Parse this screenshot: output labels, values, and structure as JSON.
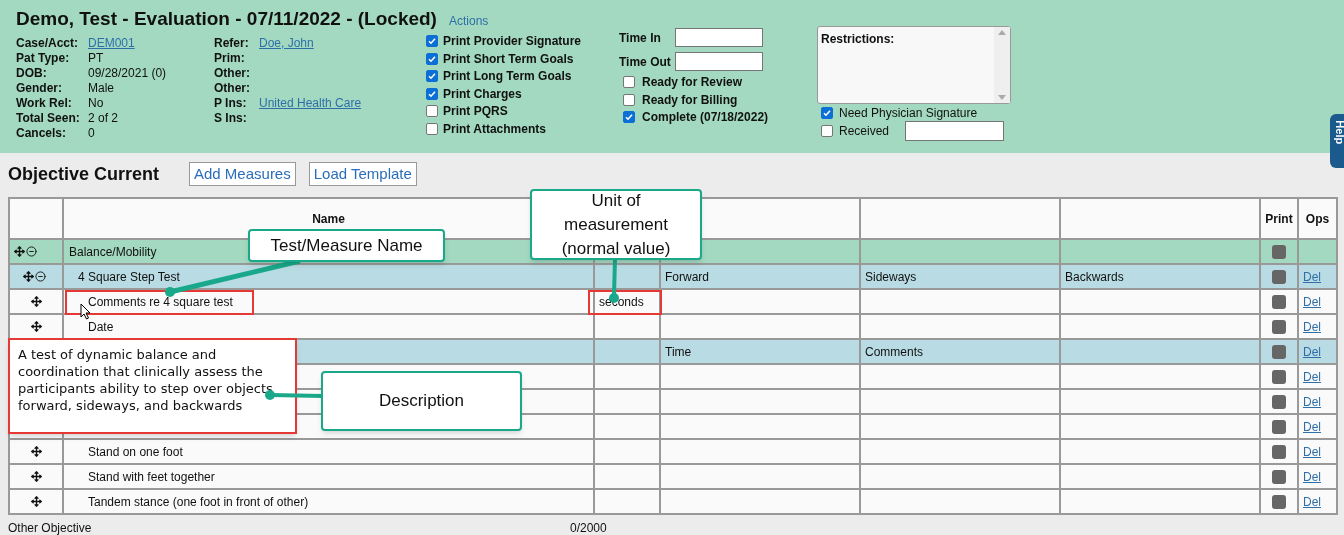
{
  "header": {
    "title": "Demo, Test - Evaluation - 07/11/2022 - (Locked)",
    "actions": "Actions",
    "patient_fields": [
      {
        "label": "Case/Acct:",
        "value": "DEM001",
        "link": true
      },
      {
        "label": "Pat Type:",
        "value": "PT",
        "link": false
      },
      {
        "label": "DOB:",
        "value": "09/28/2021 (0)",
        "link": false
      },
      {
        "label": "Gender:",
        "value": "Male",
        "link": false
      },
      {
        "label": "Work Rel:",
        "value": "No",
        "link": false
      },
      {
        "label": "Total Seen:",
        "value": "2 of 2",
        "link": false
      },
      {
        "label": "Cancels:",
        "value": "0",
        "link": false
      }
    ],
    "referral_fields": [
      {
        "label": "Refer:",
        "value": "Doe, John",
        "link": true
      },
      {
        "label": "Prim:"
      },
      {
        "label": "Other:"
      },
      {
        "label": "Other:"
      },
      {
        "label": "P Ins:",
        "value": "United Health Care",
        "link": true
      },
      {
        "label": "S Ins:"
      }
    ],
    "print_options": [
      {
        "label": "Print Provider Signature",
        "checked": true
      },
      {
        "label": "Print Short Term Goals",
        "checked": true
      },
      {
        "label": "Print Long Term Goals",
        "checked": true
      },
      {
        "label": "Print Charges",
        "checked": true
      },
      {
        "label": "Print PQRS",
        "checked": false
      },
      {
        "label": "Print Attachments",
        "checked": false
      }
    ],
    "time_fields": [
      {
        "label": "Time In"
      },
      {
        "label": "Time Out"
      }
    ],
    "status_options": [
      {
        "label": "Ready for Review",
        "checked": false
      },
      {
        "label": "Ready for Billing",
        "checked": false
      },
      {
        "label": "Complete (07/18/2022)",
        "checked": true
      }
    ],
    "restrictions": {
      "label": "Restrictions:"
    },
    "signature_options": [
      {
        "label": "Need Physician Signature",
        "checked": true,
        "field": false
      },
      {
        "label": "Received",
        "checked": false,
        "field": true
      }
    ],
    "help_tab": "Help"
  },
  "section": {
    "title": "Objective Current",
    "buttons": [
      "Add Measures",
      "Load Template"
    ]
  },
  "table": {
    "columns": [
      {
        "label": "Name"
      },
      {},
      {},
      {},
      {},
      {
        "label": "Print"
      },
      {
        "label": "Ops"
      }
    ],
    "rows": [
      {
        "name": "Balance/Mobility",
        "children": [
          {
            "name": "4 Square Step Test",
            "column_3": "Forward",
            "column_4": "Sideways",
            "column_5": "Backwards",
            "ops": "Del",
            "children": [
              {
                "name": "Comments re 4 square test",
                "unit": "seconds",
                "ops": "Del"
              },
              {
                "name": "Date",
                "ops": "Del"
              }
            ]
          },
          {
            "column_3": "Time",
            "column_4": "Comments",
            "ops": "Del",
            "children": [
              {
                "ops": "Del"
              },
              {
                "ops": "Del"
              },
              {
                "ops": "Del"
              },
              {
                "name": "Stand on one foot",
                "ops": "Del"
              },
              {
                "name": "Stand with feet together",
                "ops": "Del"
              },
              {
                "name": "Tandem stance (one foot in front of other)",
                "ops": "Del"
              }
            ]
          }
        ]
      }
    ]
  },
  "callouts": [
    {
      "kind": "name",
      "text": "Test/Measure Name"
    },
    {
      "kind": "unit",
      "text": "Unit of measurement (normal value)"
    },
    {
      "kind": "description",
      "text": "Description"
    }
  ],
  "description_note": "A test of dynamic balance and coordination that clinically assess the participants ability to step over objects forward, sideways, and backwards",
  "footer": {
    "label": "Other Objective",
    "counter": "0/2000"
  }
}
